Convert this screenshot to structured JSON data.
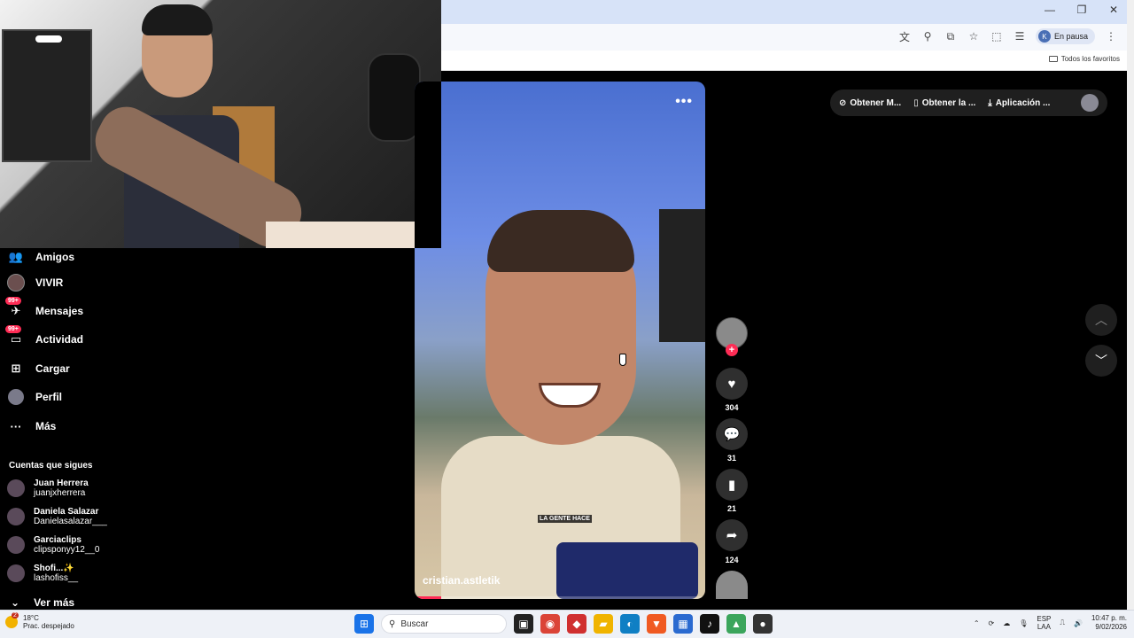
{
  "browser": {
    "profile_initial": "K",
    "profile_status": "En pausa",
    "bookmarks_folder": "Todos los favoritos"
  },
  "nav": {
    "items": [
      {
        "label": "Amigos"
      },
      {
        "label": "VIVIR"
      },
      {
        "label": "Mensajes",
        "badge": "99+"
      },
      {
        "label": "Actividad",
        "badge": "99+"
      },
      {
        "label": "Cargar"
      },
      {
        "label": "Perfil"
      },
      {
        "label": "Más"
      }
    ],
    "following_title": "Cuentas que sigues",
    "following": [
      {
        "name": "Juan Herrera",
        "handle": "juanjxherrera"
      },
      {
        "name": "Daniela Salazar",
        "handle": "Danielasalazar___"
      },
      {
        "name": "Garciaclips",
        "handle": "clipsponyy12__0"
      },
      {
        "name": "Shofi...✨",
        "handle": "lashofiss__"
      }
    ],
    "see_more": "Ver más"
  },
  "video": {
    "author": "cristian.astletik",
    "subtitle": "LA GENTE HACE",
    "more_icon": "•••",
    "progress": 0.09
  },
  "actions": {
    "likes": "304",
    "comments": "31",
    "saves": "21",
    "shares": "124"
  },
  "top_pills": {
    "coins": "Obtener M...",
    "app": "Obtener la ...",
    "desktop": "Aplicación ..."
  },
  "taskbar": {
    "temperature": "18°C",
    "weather_desc": "Prac. despejado",
    "weather_badge": "2",
    "search_placeholder": "Buscar",
    "lang_top": "ESP",
    "lang_bottom": "LAA",
    "time": "10:47 p. m.",
    "date": "9/02/2026"
  }
}
